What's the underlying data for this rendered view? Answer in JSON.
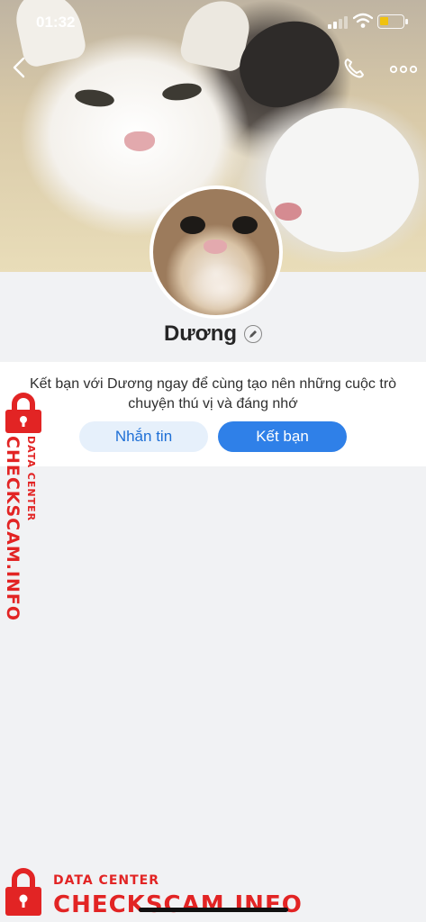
{
  "status_bar": {
    "time": "01:32"
  },
  "profile": {
    "name": "Dương",
    "description": "Kết bạn với Dương ngay để cùng tạo nên những cuộc trò chuyện thú vị và đáng nhớ",
    "message_button": "Nhắn tin",
    "add_friend_button": "Kết bạn"
  },
  "watermark": {
    "small": "DATA CENTER",
    "big": "CHECKSCAM.INFO",
    "color": "#e22424"
  },
  "colors": {
    "accent": "#2f80e8",
    "accent_light": "#e6f0fb",
    "battery": "#f5c400"
  },
  "icons": [
    "back-icon",
    "phone-icon",
    "more-icon",
    "edit-icon",
    "lock-icon",
    "wifi-icon",
    "signal-icon",
    "battery-icon"
  ]
}
